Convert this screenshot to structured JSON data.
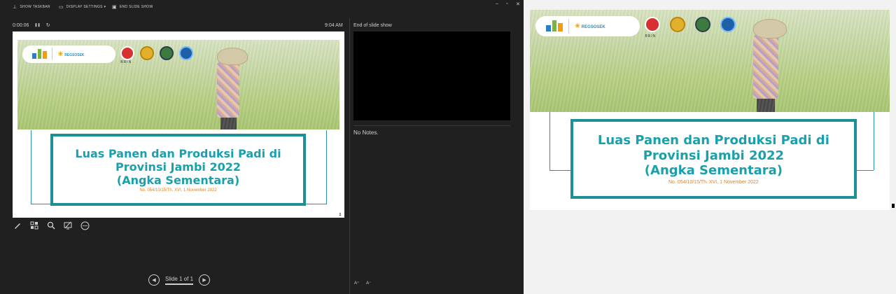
{
  "toolbar": {
    "show_taskbar": "SHOW TASKBAR",
    "display_settings": "DISPLAY SETTINGS ▾",
    "end_slide_show": "END SLIDE SHOW"
  },
  "window_controls": {
    "minimize": "–",
    "restore": "▫",
    "close": "✕"
  },
  "timer": {
    "elapsed": "0:00:06",
    "pause_icon": "❚❚",
    "reset_icon": "↻"
  },
  "clock": "9:04 AM",
  "next_slide_label": "End of slide show",
  "notes_text": "No Notes.",
  "navigation": {
    "slide_counter": "Slide 1 of 1",
    "prev": "◀",
    "next": "▶"
  },
  "font_buttons": {
    "increase": "A⁺",
    "decrease": "A⁻"
  },
  "slide": {
    "logo_name": "REGSOSEK",
    "logo_tag": "BRIN",
    "title_lines": [
      "Luas Panen dan Produksi Padi di",
      "Provinsi Jambi 2022",
      "(Angka Sementara)"
    ],
    "subtitle": "No. 054/10/15/Th. XVI, 1 November 2022",
    "page_number": "1"
  },
  "colors": {
    "teal": "#1aa0ad",
    "orange": "#e2811e",
    "dark_bg": "#202020"
  }
}
